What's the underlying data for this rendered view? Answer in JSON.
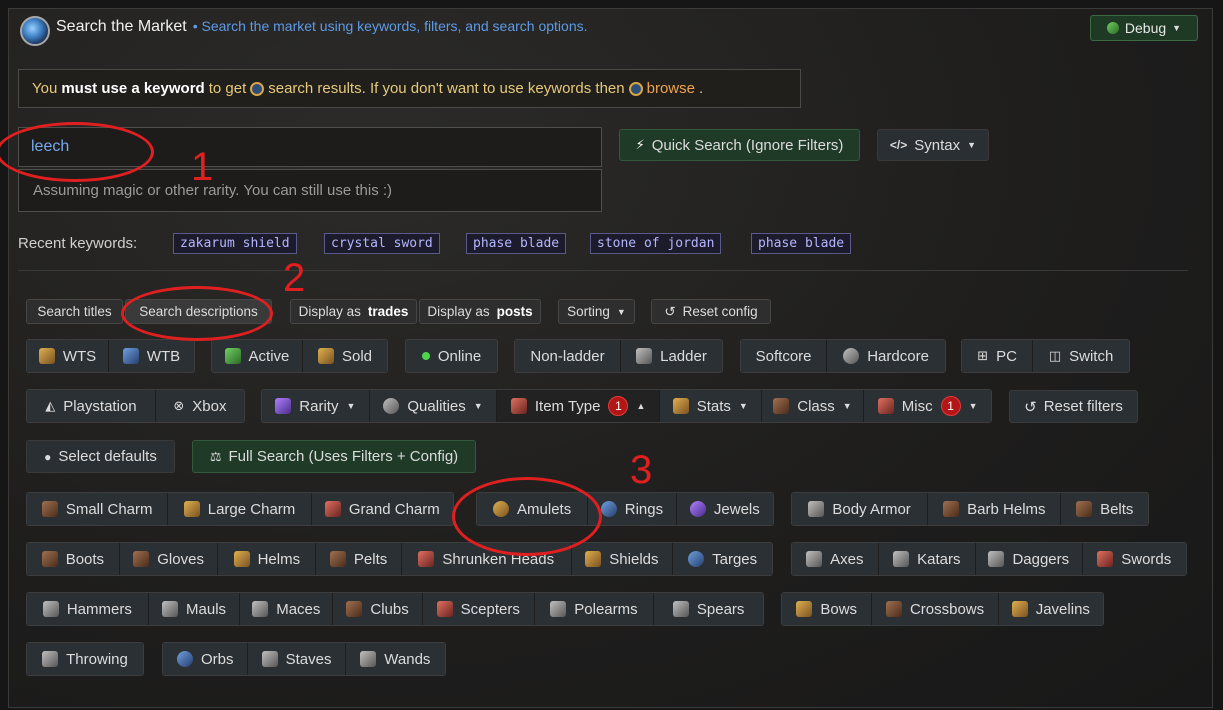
{
  "header": {
    "title": "Search the Market",
    "subtitle": "• Search the market using keywords, filters, and search options.",
    "debug_label": "Debug"
  },
  "notice": {
    "part1": "You",
    "part2": "must use a keyword",
    "part3": "to get",
    "part4": "search results. If you don't want to use keywords then",
    "browse": "browse",
    "end": "."
  },
  "search": {
    "keyword_value": "leech",
    "hint": "Assuming magic or other rarity. You can still use this :)",
    "quick_search": "Quick Search (Ignore Filters)",
    "syntax": "Syntax"
  },
  "recent": {
    "label": "Recent keywords:",
    "tags": [
      "zakarum shield",
      "crystal sword",
      "phase blade",
      "stone of jordan",
      "phase blade"
    ]
  },
  "config": {
    "search_titles": "Search titles",
    "search_descriptions": "Search descriptions",
    "display_trades_pre": "Display as",
    "display_trades_bold": "trades",
    "display_posts_pre": "Display as",
    "display_posts_bold": "posts",
    "sorting": "Sorting",
    "reset_config": "Reset config"
  },
  "filters": {
    "wts": "WTS",
    "wtb": "WTB",
    "active": "Active",
    "sold": "Sold",
    "online": "Online",
    "nonladder": "Non-ladder",
    "ladder": "Ladder",
    "softcore": "Softcore",
    "hardcore": "Hardcore",
    "pc": "PC",
    "switch": "Switch",
    "playstation": "Playstation",
    "xbox": "Xbox",
    "rarity": "Rarity",
    "qualities": "Qualities",
    "item_type": "Item Type",
    "item_type_badge": "1",
    "stats": "Stats",
    "class": "Class",
    "misc": "Misc",
    "misc_badge": "1",
    "reset_filters": "Reset filters",
    "select_defaults": "Select defaults",
    "full_search": "Full Search (Uses Filters + Config)"
  },
  "items": {
    "small_charm": "Small Charm",
    "large_charm": "Large Charm",
    "grand_charm": "Grand Charm",
    "amulets": "Amulets",
    "rings": "Rings",
    "jewels": "Jewels",
    "body_armor": "Body Armor",
    "barb_helms": "Barb Helms",
    "belts": "Belts",
    "boots": "Boots",
    "gloves": "Gloves",
    "helms": "Helms",
    "pelts": "Pelts",
    "shrunken_heads": "Shrunken Heads",
    "shields": "Shields",
    "targes": "Targes",
    "axes": "Axes",
    "katars": "Katars",
    "daggers": "Daggers",
    "swords": "Swords",
    "hammers": "Hammers",
    "mauls": "Mauls",
    "maces": "Maces",
    "clubs": "Clubs",
    "scepters": "Scepters",
    "polearms": "Polearms",
    "spears": "Spears",
    "bows": "Bows",
    "crossbows": "Crossbows",
    "javelins": "Javelins",
    "throwing": "Throwing",
    "orbs": "Orbs",
    "staves": "Staves",
    "wands": "Wands"
  },
  "annotations": {
    "one": "1",
    "two": "2",
    "three": "3"
  }
}
